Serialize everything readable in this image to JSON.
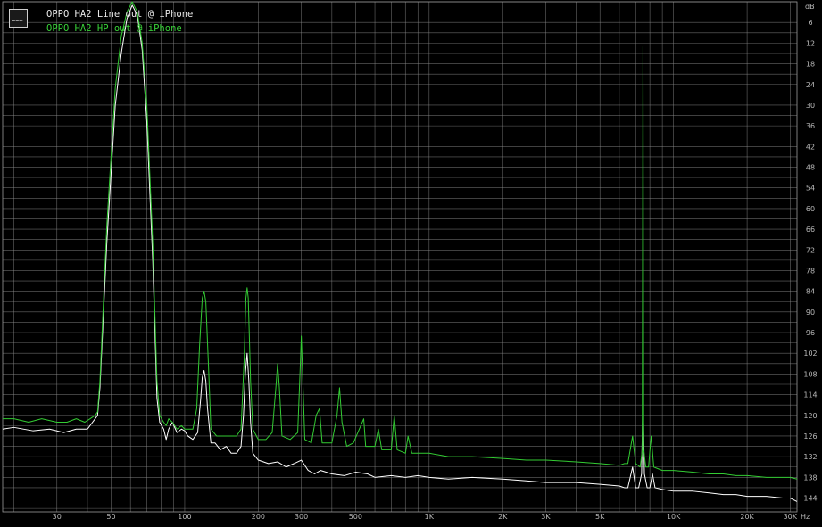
{
  "chart_data": {
    "type": "line",
    "title": "",
    "xlabel": "",
    "ylabel": "",
    "x_scale": "log",
    "xlim": [
      18,
      32000
    ],
    "ylim": [
      -148,
      0
    ],
    "y_unit_label": "dB",
    "x_unit_label": "Hz",
    "grid": true,
    "legend_position": "top-left",
    "x_tick_labels": [
      {
        "label": "30",
        "value": 30
      },
      {
        "label": "50",
        "value": 50
      },
      {
        "label": "100",
        "value": 100
      },
      {
        "label": "200",
        "value": 200
      },
      {
        "label": "300",
        "value": 300
      },
      {
        "label": "500",
        "value": 500
      },
      {
        "label": "1K",
        "value": 1000
      },
      {
        "label": "2K",
        "value": 2000
      },
      {
        "label": "3K",
        "value": 3000
      },
      {
        "label": "5K",
        "value": 5000
      },
      {
        "label": "10K",
        "value": 10000
      },
      {
        "label": "20K",
        "value": 20000
      },
      {
        "label": "30K",
        "value": 30000
      }
    ],
    "y_tick_labels": [
      "6",
      "12",
      "18",
      "24",
      "30",
      "36",
      "42",
      "48",
      "54",
      "60",
      "66",
      "72",
      "78",
      "84",
      "90",
      "96",
      "102",
      "108",
      "114",
      "120",
      "126",
      "132",
      "138",
      "144"
    ],
    "series": [
      {
        "name": "OPPO HA2 Line out @ iPhone",
        "color": "#ffffff",
        "points": [
          [
            18,
            -124
          ],
          [
            20,
            -123.5
          ],
          [
            24,
            -124.5
          ],
          [
            28,
            -124
          ],
          [
            32,
            -125
          ],
          [
            36,
            -124
          ],
          [
            40,
            -124
          ],
          [
            43,
            -121
          ],
          [
            44,
            -120
          ],
          [
            45,
            -112
          ],
          [
            48,
            -70
          ],
          [
            52,
            -30
          ],
          [
            55,
            -15
          ],
          [
            58,
            -5
          ],
          [
            61,
            -1
          ],
          [
            64,
            -4
          ],
          [
            67,
            -14
          ],
          [
            70,
            -35
          ],
          [
            74,
            -75
          ],
          [
            77,
            -115
          ],
          [
            79,
            -122
          ],
          [
            82,
            -124
          ],
          [
            84,
            -127
          ],
          [
            86,
            -124
          ],
          [
            89,
            -122
          ],
          [
            93,
            -125
          ],
          [
            97,
            -124
          ],
          [
            100,
            -124.5
          ],
          [
            103,
            -126
          ],
          [
            108,
            -127
          ],
          [
            113,
            -125
          ],
          [
            116,
            -116
          ],
          [
            118,
            -109
          ],
          [
            120,
            -107
          ],
          [
            122,
            -110
          ],
          [
            124,
            -118
          ],
          [
            128,
            -128
          ],
          [
            133,
            -128
          ],
          [
            140,
            -130
          ],
          [
            148,
            -129
          ],
          [
            155,
            -131
          ],
          [
            163,
            -131
          ],
          [
            170,
            -129
          ],
          [
            174,
            -120
          ],
          [
            177,
            -108
          ],
          [
            180,
            -102
          ],
          [
            183,
            -110
          ],
          [
            186,
            -122
          ],
          [
            190,
            -131
          ],
          [
            200,
            -133
          ],
          [
            220,
            -134
          ],
          [
            240,
            -133.5
          ],
          [
            260,
            -135
          ],
          [
            280,
            -134
          ],
          [
            300,
            -133
          ],
          [
            320,
            -136
          ],
          [
            340,
            -137
          ],
          [
            360,
            -136
          ],
          [
            400,
            -137
          ],
          [
            450,
            -137.5
          ],
          [
            500,
            -136.5
          ],
          [
            560,
            -137
          ],
          [
            600,
            -138
          ],
          [
            700,
            -137.5
          ],
          [
            800,
            -138
          ],
          [
            900,
            -137.5
          ],
          [
            1000,
            -138
          ],
          [
            1200,
            -138.5
          ],
          [
            1500,
            -138
          ],
          [
            2000,
            -138.5
          ],
          [
            2500,
            -139
          ],
          [
            3000,
            -139.5
          ],
          [
            4000,
            -139.5
          ],
          [
            5000,
            -140
          ],
          [
            6000,
            -140.5
          ],
          [
            6300,
            -141
          ],
          [
            6500,
            -141
          ],
          [
            6800,
            -135
          ],
          [
            7000,
            -141
          ],
          [
            7200,
            -141
          ],
          [
            7400,
            -137
          ],
          [
            7500,
            -114
          ],
          [
            7600,
            -137
          ],
          [
            7800,
            -141
          ],
          [
            8000,
            -141
          ],
          [
            8200,
            -137
          ],
          [
            8400,
            -141
          ],
          [
            9000,
            -141.5
          ],
          [
            10000,
            -142
          ],
          [
            12000,
            -142
          ],
          [
            14000,
            -142.5
          ],
          [
            16000,
            -143
          ],
          [
            18000,
            -143
          ],
          [
            20000,
            -143.5
          ],
          [
            24000,
            -143.5
          ],
          [
            28000,
            -144
          ],
          [
            30000,
            -144
          ],
          [
            32000,
            -145
          ]
        ]
      },
      {
        "name": "OPPO HA2 HP out @ iPhone",
        "color": "#33cc33",
        "points": [
          [
            18,
            -121
          ],
          [
            20,
            -121
          ],
          [
            23,
            -122
          ],
          [
            26,
            -121
          ],
          [
            30,
            -122
          ],
          [
            33,
            -122
          ],
          [
            36,
            -121
          ],
          [
            39,
            -122
          ],
          [
            41,
            -121
          ],
          [
            43,
            -120
          ],
          [
            44,
            -119
          ],
          [
            45,
            -110
          ],
          [
            48,
            -65
          ],
          [
            52,
            -25
          ],
          [
            55,
            -10
          ],
          [
            58,
            -3
          ],
          [
            61,
            0
          ],
          [
            64,
            -3
          ],
          [
            67,
            -12
          ],
          [
            70,
            -30
          ],
          [
            74,
            -70
          ],
          [
            77,
            -110
          ],
          [
            79,
            -120
          ],
          [
            82,
            -122
          ],
          [
            84,
            -123
          ],
          [
            86,
            -121
          ],
          [
            89,
            -122
          ],
          [
            93,
            -124
          ],
          [
            97,
            -123
          ],
          [
            100,
            -124
          ],
          [
            103,
            -124
          ],
          [
            108,
            -124
          ],
          [
            112,
            -118
          ],
          [
            115,
            -100
          ],
          [
            118,
            -86
          ],
          [
            120,
            -84
          ],
          [
            122,
            -87
          ],
          [
            125,
            -105
          ],
          [
            128,
            -124
          ],
          [
            135,
            -126
          ],
          [
            145,
            -126
          ],
          [
            155,
            -126
          ],
          [
            163,
            -126
          ],
          [
            170,
            -124
          ],
          [
            175,
            -104
          ],
          [
            178,
            -86
          ],
          [
            180,
            -83
          ],
          [
            182,
            -86
          ],
          [
            186,
            -110
          ],
          [
            190,
            -124
          ],
          [
            200,
            -127
          ],
          [
            215,
            -127
          ],
          [
            228,
            -125
          ],
          [
            236,
            -112
          ],
          [
            240,
            -105
          ],
          [
            244,
            -112
          ],
          [
            250,
            -126
          ],
          [
            270,
            -127
          ],
          [
            290,
            -125
          ],
          [
            297,
            -106
          ],
          [
            300,
            -97
          ],
          [
            303,
            -106
          ],
          [
            310,
            -127
          ],
          [
            330,
            -128
          ],
          [
            345,
            -120
          ],
          [
            356,
            -118
          ],
          [
            365,
            -128
          ],
          [
            400,
            -128
          ],
          [
            420,
            -120
          ],
          [
            430,
            -112
          ],
          [
            440,
            -122
          ],
          [
            460,
            -129
          ],
          [
            490,
            -128
          ],
          [
            540,
            -121
          ],
          [
            550,
            -129
          ],
          [
            600,
            -129
          ],
          [
            620,
            -124
          ],
          [
            640,
            -130
          ],
          [
            700,
            -130
          ],
          [
            720,
            -120
          ],
          [
            740,
            -130
          ],
          [
            800,
            -131
          ],
          [
            820,
            -126
          ],
          [
            850,
            -131
          ],
          [
            900,
            -131
          ],
          [
            1000,
            -131
          ],
          [
            1200,
            -132
          ],
          [
            1500,
            -132
          ],
          [
            2000,
            -132.5
          ],
          [
            2500,
            -133
          ],
          [
            3000,
            -133
          ],
          [
            4000,
            -133.5
          ],
          [
            5000,
            -134
          ],
          [
            6000,
            -134.5
          ],
          [
            6300,
            -134
          ],
          [
            6500,
            -134
          ],
          [
            6800,
            -126
          ],
          [
            7000,
            -134
          ],
          [
            7300,
            -135
          ],
          [
            7450,
            -130
          ],
          [
            7500,
            -13
          ],
          [
            7550,
            -130
          ],
          [
            7700,
            -135
          ],
          [
            7900,
            -135
          ],
          [
            8100,
            -126
          ],
          [
            8300,
            -135
          ],
          [
            9000,
            -136
          ],
          [
            10000,
            -136
          ],
          [
            12000,
            -136.5
          ],
          [
            14000,
            -137
          ],
          [
            16000,
            -137
          ],
          [
            18000,
            -137.5
          ],
          [
            20000,
            -137.5
          ],
          [
            24000,
            -138
          ],
          [
            28000,
            -138
          ],
          [
            30000,
            -138
          ],
          [
            32000,
            -138.5
          ]
        ]
      }
    ]
  }
}
